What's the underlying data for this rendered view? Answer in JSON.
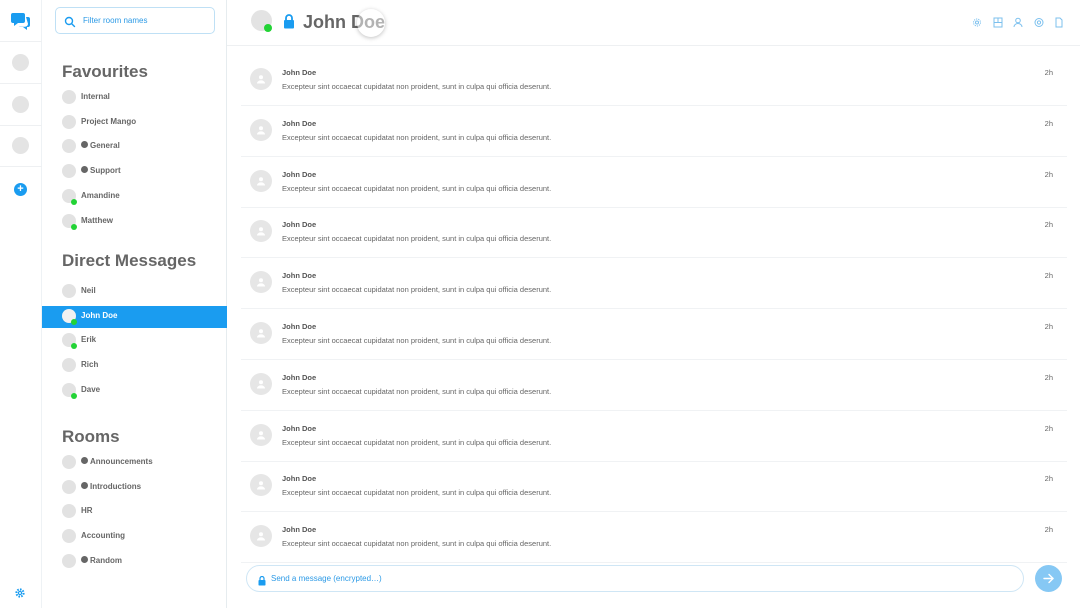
{
  "colors": {
    "accent": "#1a9cf0",
    "online": "#22d335",
    "text": "#666666"
  },
  "rail": {
    "add_label": "+"
  },
  "search": {
    "placeholder": "Filter room names"
  },
  "sections": {
    "favourites": "Favourites",
    "direct": "Direct Messages",
    "rooms": "Rooms"
  },
  "favourites": [
    {
      "label": "Internal",
      "public": false,
      "online": false
    },
    {
      "label": "Project Mango",
      "public": false,
      "online": false
    },
    {
      "label": "General",
      "public": true,
      "online": false
    },
    {
      "label": "Support",
      "public": true,
      "online": false
    },
    {
      "label": "Amandine",
      "public": false,
      "online": true
    },
    {
      "label": "Matthew",
      "public": false,
      "online": true
    }
  ],
  "direct": [
    {
      "label": "Neil",
      "online": false
    },
    {
      "label": "John Doe",
      "online": true,
      "active": true
    },
    {
      "label": "Erik",
      "online": true
    },
    {
      "label": "Rich",
      "online": false
    },
    {
      "label": "Dave",
      "online": true
    }
  ],
  "rooms": [
    {
      "label": "Announcements",
      "public": true
    },
    {
      "label": "Introductions",
      "public": true
    },
    {
      "label": "HR",
      "public": false
    },
    {
      "label": "Accounting",
      "public": false
    },
    {
      "label": "Random",
      "public": true
    }
  ],
  "header": {
    "title": "John Doe",
    "icons": [
      "settings-icon",
      "room-directory-icon",
      "user-icon",
      "mention-icon",
      "files-icon"
    ]
  },
  "messages": [
    {
      "sender": "John Doe",
      "body": "Excepteur sint occaecat cupidatat non proident, sunt in culpa qui officia deserunt.",
      "time": "2h"
    },
    {
      "sender": "John Doe",
      "body": "Excepteur sint occaecat cupidatat non proident, sunt in culpa qui officia deserunt.",
      "time": "2h"
    },
    {
      "sender": "John Doe",
      "body": "Excepteur sint occaecat cupidatat non proident, sunt in culpa qui officia deserunt.",
      "time": "2h"
    },
    {
      "sender": "John Doe",
      "body": "Excepteur sint occaecat cupidatat non proident, sunt in culpa qui officia deserunt.",
      "time": "2h"
    },
    {
      "sender": "John Doe",
      "body": "Excepteur sint occaecat cupidatat non proident, sunt in culpa qui officia deserunt.",
      "time": "2h"
    },
    {
      "sender": "John Doe",
      "body": "Excepteur sint occaecat cupidatat non proident, sunt in culpa qui officia deserunt.",
      "time": "2h"
    },
    {
      "sender": "John Doe",
      "body": "Excepteur sint occaecat cupidatat non proident, sunt in culpa qui officia deserunt.",
      "time": "2h"
    },
    {
      "sender": "John Doe",
      "body": "Excepteur sint occaecat cupidatat non proident, sunt in culpa qui officia deserunt.",
      "time": "2h"
    },
    {
      "sender": "John Doe",
      "body": "Excepteur sint occaecat cupidatat non proident, sunt in culpa qui officia deserunt.",
      "time": "2h"
    },
    {
      "sender": "John Doe",
      "body": "Excepteur sint occaecat cupidatat non proident, sunt in culpa qui officia deserunt.",
      "time": "2h"
    }
  ],
  "composer": {
    "placeholder": "Send a message (encrypted…)"
  }
}
